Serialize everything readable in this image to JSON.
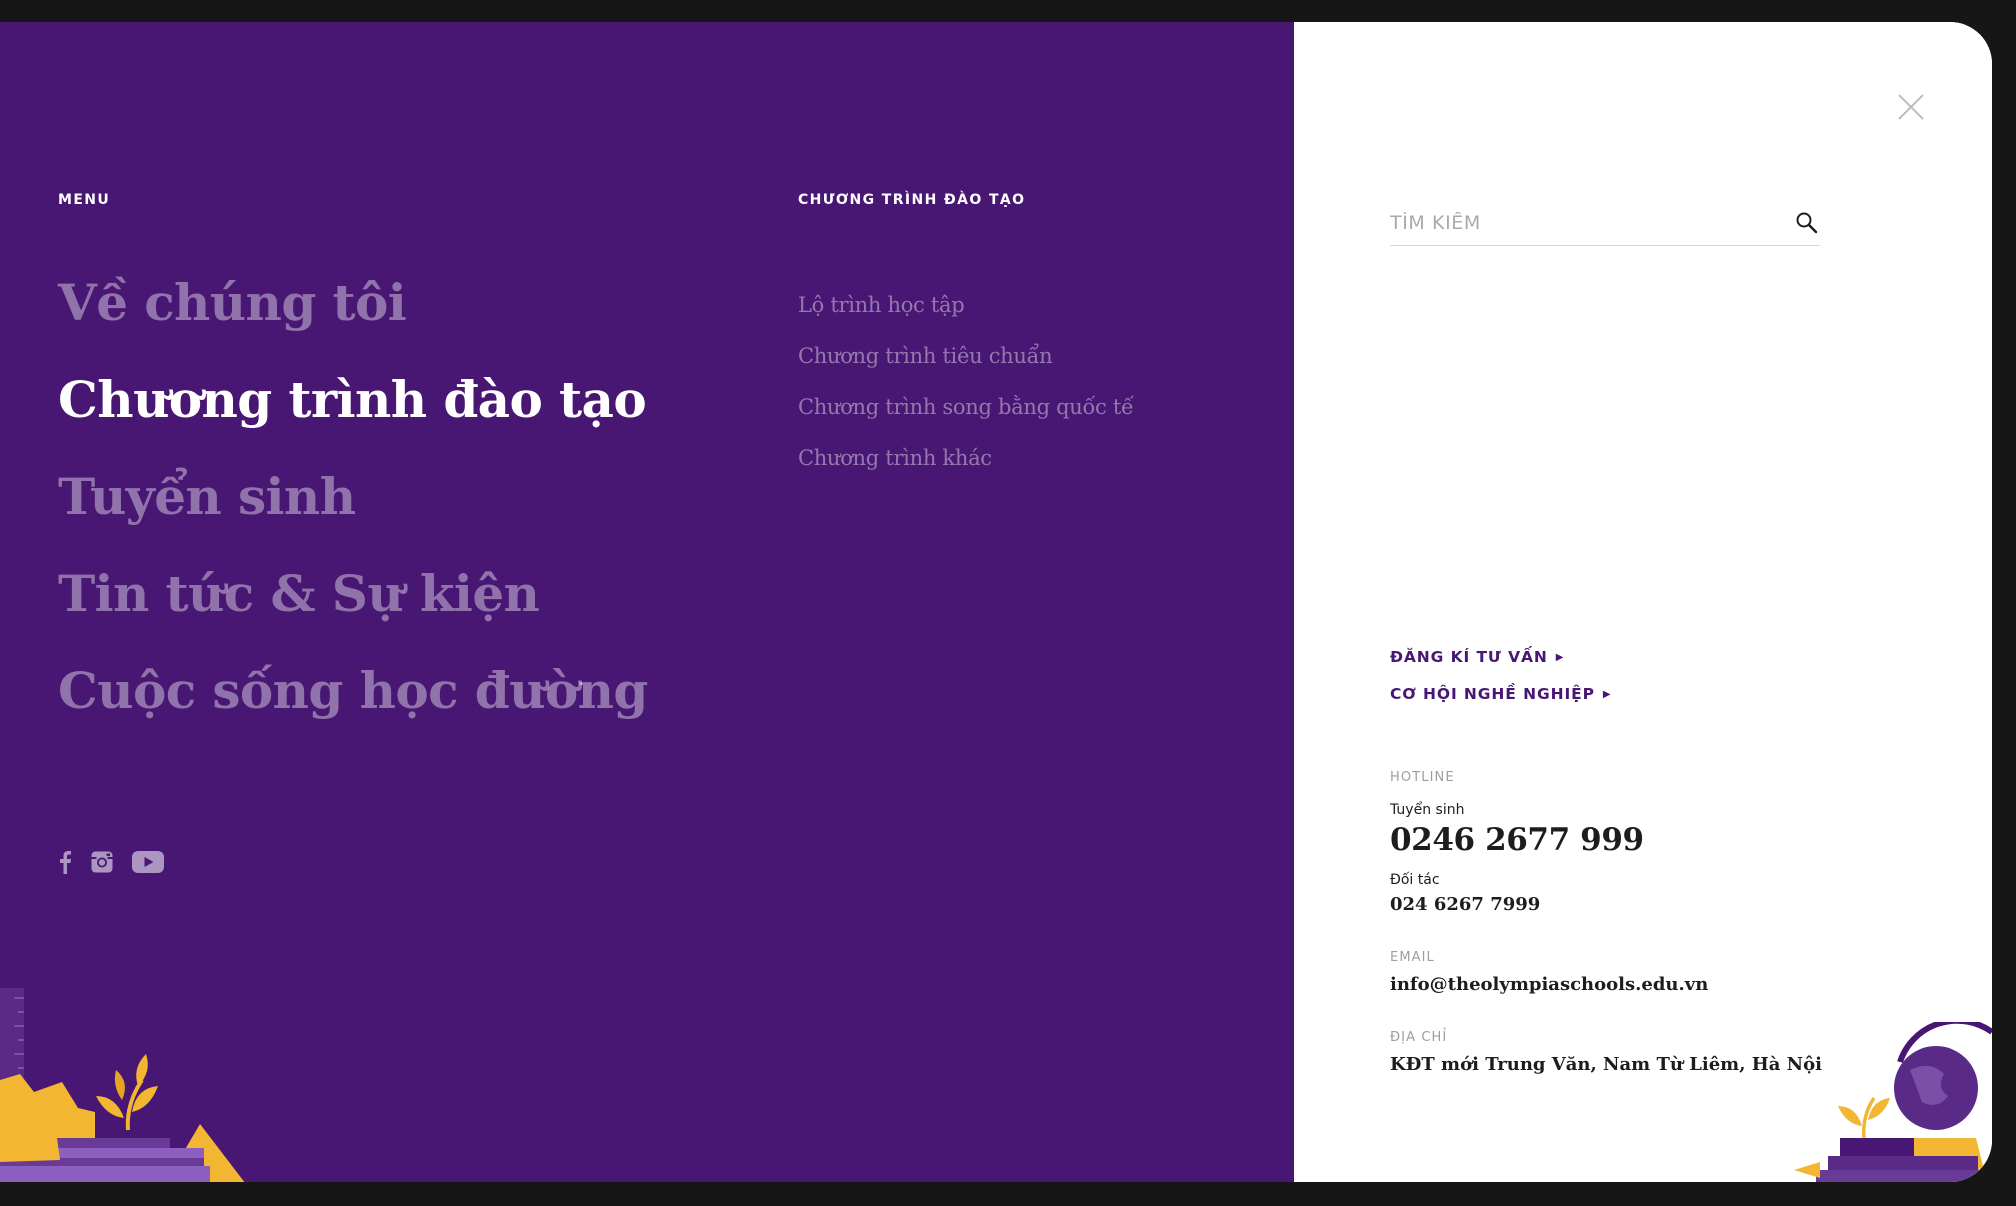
{
  "colors": {
    "primary_purple": "#481673",
    "accent_yellow": "#F2B632",
    "white": "#FFFFFF",
    "text_dark": "#1D1D1D",
    "text_muted": "#9E9E9E"
  },
  "menu": {
    "label": "MENU",
    "items": [
      {
        "label": "Về chúng tôi",
        "active": false
      },
      {
        "label": "Chương trình đào tạo",
        "active": true
      },
      {
        "label": "Tuyển sinh",
        "active": false
      },
      {
        "label": "Tin tức & Sự kiện",
        "active": false
      },
      {
        "label": "Cuộc sống học đường",
        "active": false
      }
    ]
  },
  "submenu": {
    "label": "CHƯƠNG TRÌNH ĐÀO TẠO",
    "items": [
      {
        "label": "Lộ trình học tập"
      },
      {
        "label": "Chương trình tiêu chuẩn"
      },
      {
        "label": "Chương trình song bằng quốc tế"
      },
      {
        "label": "Chương trình khác"
      }
    ]
  },
  "social": {
    "icons": [
      "facebook-icon",
      "instagram-icon",
      "youtube-icon"
    ]
  },
  "search": {
    "placeholder": "TÌM KIẾM",
    "value": ""
  },
  "cta": {
    "register": "ĐĂNG KÍ TƯ VẤN",
    "careers": "CƠ HỘI NGHỀ NGHIỆP"
  },
  "contact": {
    "hotline_label": "HOTLINE",
    "admissions_label": "Tuyển sinh",
    "admissions_phone": "0246 2677 999",
    "partners_label": "Đối tác",
    "partners_phone": "024 6267 7999",
    "email_label": "EMAIL",
    "email": "info@theolympiaschools.edu.vn",
    "address_label": "ĐỊA CHỈ",
    "address": "KĐT mới Trung Văn, Nam Từ Liêm, Hà Nội"
  }
}
